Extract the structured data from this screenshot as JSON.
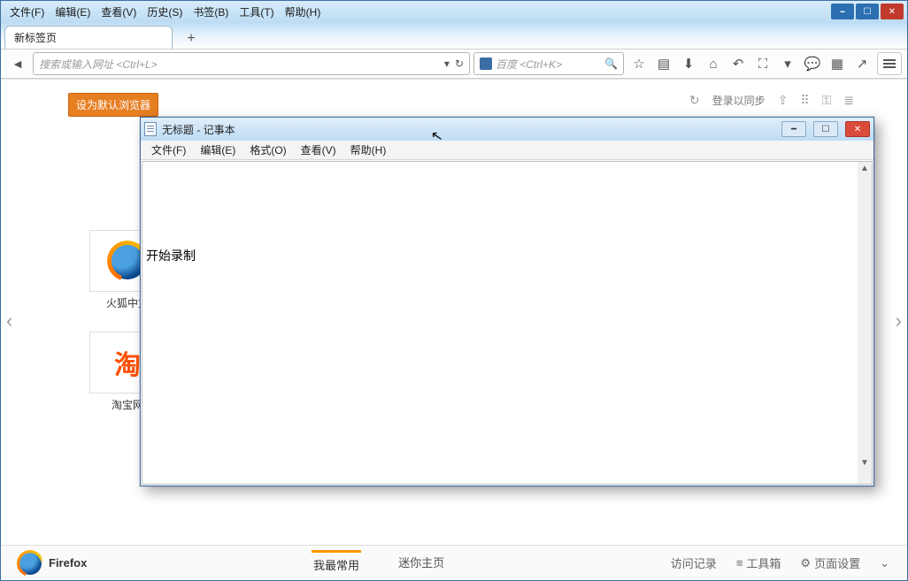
{
  "firefox": {
    "menubar": [
      "文件(F)",
      "编辑(E)",
      "查看(V)",
      "历史(S)",
      "书签(B)",
      "工具(T)",
      "帮助(H)"
    ],
    "tab_title": "新标签页",
    "urlbar_placeholder": "搜索或输入网址  <Ctrl+L>",
    "searchbar_placeholder": "百度 <Ctrl+K>",
    "set_default_btn": "设为默认浏览器",
    "sync_login": "登录以同步",
    "tiles": [
      {
        "label": "火狐中文",
        "kind": "firefox"
      },
      {
        "label": "淘宝网",
        "kind": "taobao"
      }
    ],
    "bottom": {
      "brand": "Firefox",
      "tabs": [
        {
          "label": "我最常用",
          "active": true
        },
        {
          "label": "迷你主页",
          "active": false
        }
      ],
      "right": [
        "访问记录",
        "工具箱",
        "页面设置"
      ]
    }
  },
  "notepad": {
    "title": "无标题 - 记事本",
    "menubar": [
      "文件(F)",
      "编辑(E)",
      "格式(O)",
      "查看(V)",
      "帮助(H)"
    ],
    "content": "开始录制"
  }
}
